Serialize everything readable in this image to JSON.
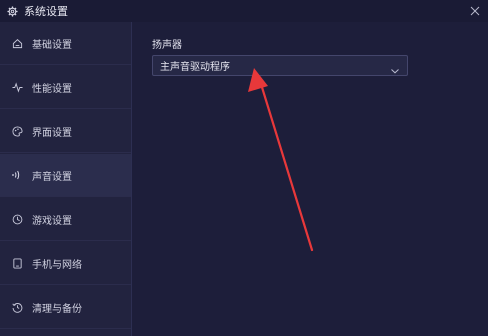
{
  "window": {
    "title": "系统设置"
  },
  "sidebar": {
    "items": [
      {
        "label": "基础设置",
        "icon": "home-icon",
        "active": false
      },
      {
        "label": "性能设置",
        "icon": "pulse-icon",
        "active": false
      },
      {
        "label": "界面设置",
        "icon": "palette-icon",
        "active": false
      },
      {
        "label": "声音设置",
        "icon": "sound-icon",
        "active": true
      },
      {
        "label": "游戏设置",
        "icon": "clock-icon",
        "active": false
      },
      {
        "label": "手机与网络",
        "icon": "phone-icon",
        "active": false
      },
      {
        "label": "清理与备份",
        "icon": "history-icon",
        "active": false
      }
    ]
  },
  "content": {
    "speaker": {
      "label": "扬声器",
      "selected": "主声音驱动程序"
    }
  },
  "colors": {
    "background": "#1d1e3a",
    "sidebar": "#22233f",
    "active_item": "#2b2d4d",
    "annotation_arrow": "#e8383a"
  }
}
